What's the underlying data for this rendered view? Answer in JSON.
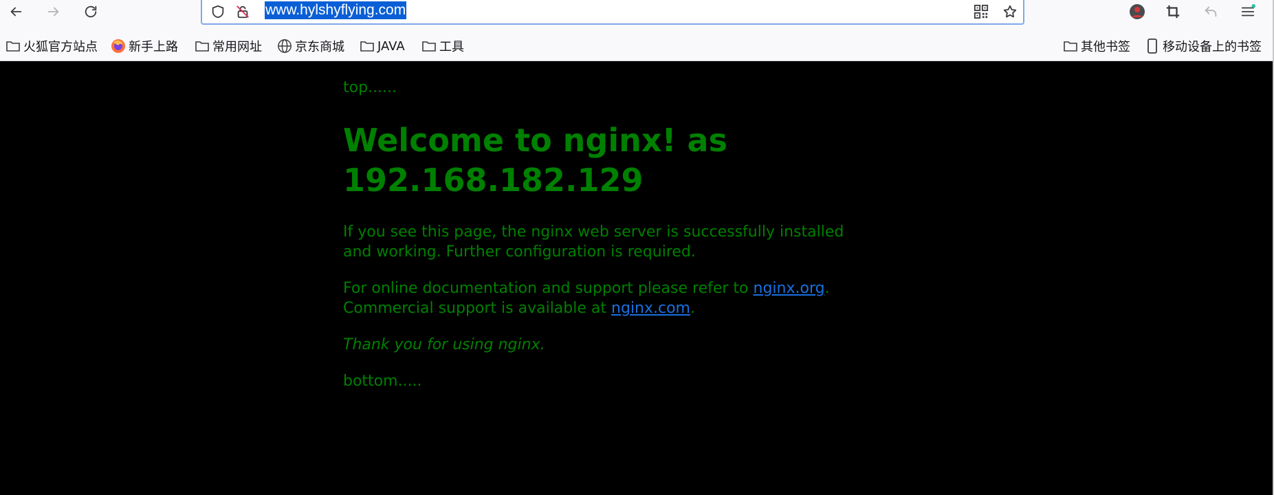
{
  "browser": {
    "url": "www.hylshyflying.com"
  },
  "bookmarks": {
    "left": [
      {
        "label": "火狐官方站点",
        "icon": "folder-icon"
      },
      {
        "label": "新手上路",
        "icon": "firefox-icon"
      },
      {
        "label": "常用网址",
        "icon": "folder-icon"
      },
      {
        "label": "京东商城",
        "icon": "globe-icon"
      },
      {
        "label": "JAVA",
        "icon": "folder-icon"
      },
      {
        "label": "工具",
        "icon": "folder-icon"
      }
    ],
    "right": [
      {
        "label": "其他书签",
        "icon": "folder-icon"
      },
      {
        "label": "移动设备上的书签",
        "icon": "mobile-icon"
      }
    ]
  },
  "page": {
    "top_text": "top......",
    "title": "Welcome to nginx! as 192.168.182.129",
    "para1": "If you see this page, the nginx web server is successfully installed and working. Further configuration is required.",
    "para2_prefix": "For online documentation and support please refer to ",
    "para2_link": "nginx.org",
    "para2_mid": ".",
    "para2_line2": "Commercial support is available at ",
    "para2_link2": "nginx.com",
    "para2_end": ".",
    "thanks": "Thank you for using nginx.",
    "bottom_text": "bottom....."
  },
  "colors": {
    "text": "#008000",
    "link": "#1a6fe0",
    "background": "#000000",
    "selection": "#0b5fd6"
  }
}
